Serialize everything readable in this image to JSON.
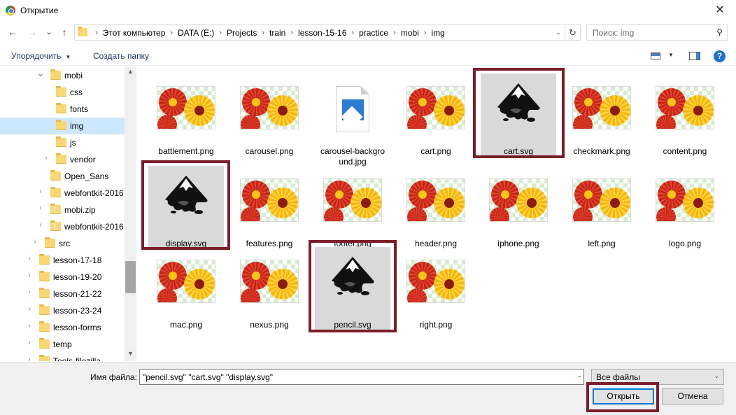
{
  "window": {
    "title": "Открытие",
    "close_glyph": "✕"
  },
  "nav": {
    "back_glyph": "←",
    "forward_glyph": "→",
    "recent_glyph": "⌄",
    "up_glyph": "↑",
    "breadcrumb": [
      "Этот компьютер",
      "DATA (E:)",
      "Projects",
      "train",
      "lesson-15-16",
      "practice",
      "mobi",
      "img"
    ],
    "search_placeholder": "Поиск: img"
  },
  "toolbar": {
    "organize_label": "Упорядочить",
    "new_folder_label": "Создать папку",
    "help_glyph": "?"
  },
  "tree": [
    {
      "label": "mobi",
      "expanded": true,
      "type": "folder"
    },
    {
      "label": "css",
      "type": "folder"
    },
    {
      "label": "fonts",
      "type": "folder"
    },
    {
      "label": "img",
      "type": "folder",
      "selected": true
    },
    {
      "label": "js",
      "type": "folder"
    },
    {
      "label": "vendor",
      "type": "folder",
      "expandable": true
    },
    {
      "label": "Open_Sans",
      "type": "folder"
    },
    {
      "label": "webfontkit-2016",
      "type": "folder",
      "expandable": true
    },
    {
      "label": "mobi.zip",
      "type": "zip",
      "expandable": true
    },
    {
      "label": "webfontkit-2016",
      "type": "zip",
      "expandable": true
    },
    {
      "label": "src",
      "type": "folder",
      "expandable": true
    },
    {
      "label": "lesson-17-18",
      "type": "folder",
      "expandable": true
    },
    {
      "label": "lesson-19-20",
      "type": "folder",
      "expandable": true
    },
    {
      "label": "lesson-21-22",
      "type": "folder",
      "expandable": true
    },
    {
      "label": "lesson-23-24",
      "type": "folder",
      "expandable": true
    },
    {
      "label": "lesson-forms",
      "type": "folder",
      "expandable": true
    },
    {
      "label": "temp",
      "type": "folder",
      "expandable": true
    },
    {
      "label": "Tools-filezilla",
      "type": "folder",
      "expandable": true
    }
  ],
  "files": [
    {
      "name": "battlement.png",
      "kind": "png"
    },
    {
      "name": "carousel.png",
      "kind": "png"
    },
    {
      "name": "carousel-background.jpg",
      "name_line1": "carousel-backgro",
      "name_line2": "und.jpg",
      "kind": "jpg"
    },
    {
      "name": "cart.png",
      "kind": "png"
    },
    {
      "name": "cart.svg",
      "kind": "svg",
      "selected": true
    },
    {
      "name": "checkmark.png",
      "kind": "png"
    },
    {
      "name": "content.png",
      "kind": "png"
    },
    {
      "name": "display.svg",
      "kind": "svg",
      "selected": true
    },
    {
      "name": "features.png",
      "kind": "png"
    },
    {
      "name": "footer.png",
      "kind": "png"
    },
    {
      "name": "header.png",
      "kind": "png"
    },
    {
      "name": "iphone.png",
      "kind": "png"
    },
    {
      "name": "left.png",
      "kind": "png"
    },
    {
      "name": "logo.png",
      "kind": "png"
    },
    {
      "name": "mac.png",
      "kind": "png"
    },
    {
      "name": "nexus.png",
      "kind": "png"
    },
    {
      "name": "pencil.svg",
      "kind": "svg",
      "selected": true
    },
    {
      "name": "right.png",
      "kind": "png"
    }
  ],
  "footer": {
    "filename_label": "Имя файла:",
    "filename_value": "\"pencil.svg\" \"cart.svg\" \"display.svg\"",
    "filetype_value": "Все файлы",
    "open_label": "Открыть",
    "cancel_label": "Отмена"
  },
  "colors": {
    "highlight_box": "#7b1e2a",
    "selection_bg": "#cce8ff",
    "accent": "#0078d7"
  }
}
